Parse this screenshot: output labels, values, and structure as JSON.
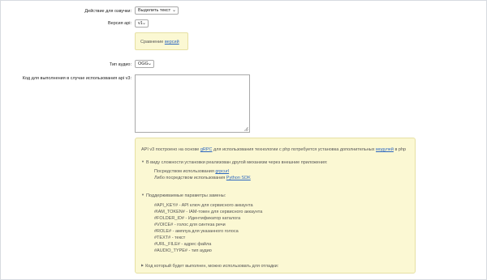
{
  "form": {
    "voice_action": {
      "label": "Действие для озвучки:",
      "value": "Выделить текст"
    },
    "api_version": {
      "label": "Версия api:",
      "value": "v1"
    },
    "compare_note": {
      "text": "Сравнение",
      "link": "версий"
    },
    "audio_type": {
      "label": "Тип аудио:",
      "value": "OGG"
    },
    "code_field": {
      "label": "Код для выполнения в случае использования api v3:",
      "value": ""
    }
  },
  "info": {
    "intro_pre": "API v3 построено на основе",
    "intro_link1": "gRPC",
    "intro_mid": "для использования технологии с php потребуется установка дополнительных",
    "intro_link2": "модулей",
    "intro_post": "в php",
    "section1_title": "В виду сложности установки реализован другой механизм через внешние приложения:",
    "via_grpcurl_text": "Посредством использования",
    "via_grpcurl_link": "grpcurl",
    "via_python_text": "Либо посредством использования",
    "via_python_link": "Python SDK",
    "section2_title": "Поддерживаемые параметры замены:",
    "params": [
      "#API_KEY# - API ключ для сервисного аккаунта",
      "#IAM_TOKEN# - IAM-токен для сервисного аккаунта",
      "#FOLDER_ID# - Идентификатор каталога",
      "#VOICE# - голос для синтеза речи",
      "#ROLE# - амплуа для указанного голоса",
      "#TEXT# - текст",
      "#URL_FILE# - адрес файла",
      "#AUDIO_TYPE# - тип аудио"
    ],
    "section3_title": "Код который будет выполнен, можно использовать для отладки:"
  },
  "icons": {
    "expanded": "triangle-down",
    "collapsed": "triangle-right",
    "dropdown": "chevron-down"
  },
  "colors": {
    "note_background": "#fbf8d3",
    "note_border": "#e6e0a3",
    "link": "#2b66c0"
  }
}
